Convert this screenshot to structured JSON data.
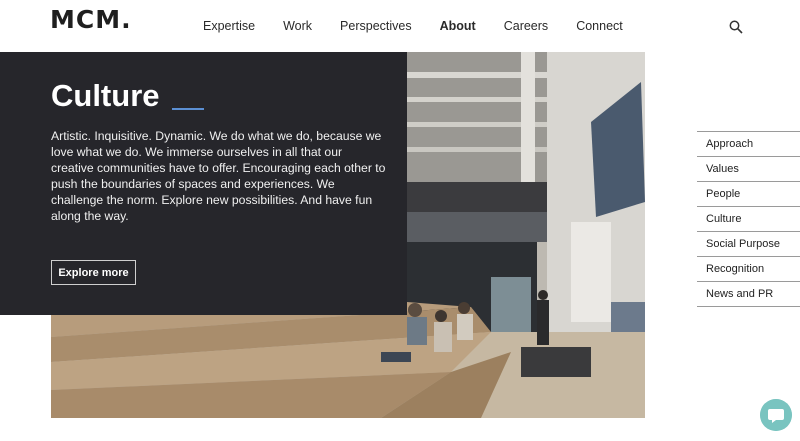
{
  "header": {
    "logo": "MCM.",
    "nav": [
      "Expertise",
      "Work",
      "Perspectives",
      "About",
      "Careers",
      "Connect"
    ],
    "active": "About",
    "search_icon": "search-icon"
  },
  "hero": {
    "title": "Culture",
    "body": "Artistic. Inquisitive. Dynamic. We do what we do, because we love what we do. We immerse ourselves in all that our creative communities have to offer. Encouraging each other to push the boundaries of spaces and experiences. We challenge the norm. Explore new possibilities. And have fun along the way.",
    "cta": "Explore more",
    "accent": "#5b8fd3",
    "panel_color": "#26262b"
  },
  "side_nav": [
    "Approach",
    "Values",
    "People",
    "Culture",
    "Social Purpose",
    "Recognition",
    "News and PR"
  ],
  "chat": {
    "icon": "chat-icon",
    "color": "#79c4c0"
  }
}
